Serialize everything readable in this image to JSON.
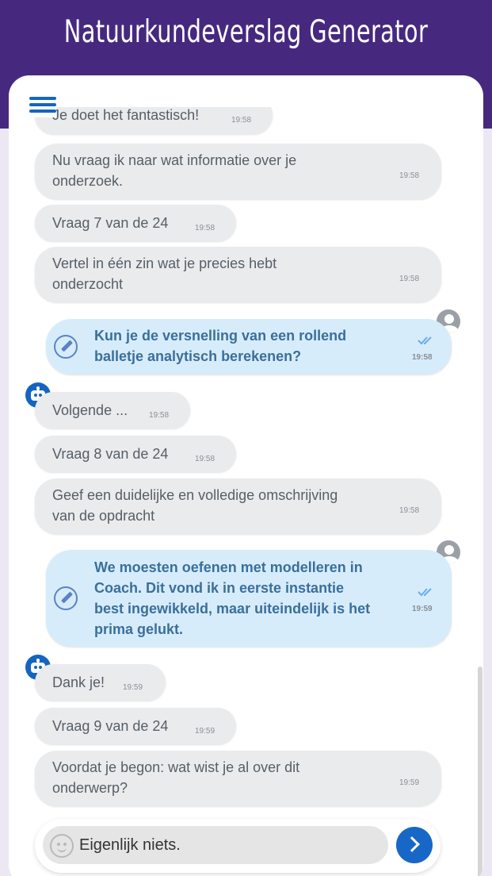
{
  "app": {
    "title": "Natuurkundeverslag Generator"
  },
  "messages": [
    {
      "text": "Je doet het fantastisch!",
      "time": "19:58"
    },
    {
      "line1": "Nu vraag ik naar wat informatie over je",
      "line2": "onderzoek.",
      "time": "19:58"
    },
    {
      "text": "Vraag 7 van de 24",
      "time": "19:58"
    },
    {
      "line1": "Vertel in één zin wat je precies hebt",
      "line2": "onderzocht",
      "time": "19:58"
    },
    {
      "line1": "Kun je de versnelling van een rollend",
      "line2": "balletje analytisch berekenen?",
      "time": "19:58"
    },
    {
      "text": "Volgende ...",
      "time": "19:58"
    },
    {
      "text": "Vraag 8 van de 24",
      "time": "19:58"
    },
    {
      "line1": "Geef een duidelijke en volledige omschrijving",
      "line2": "van de opdracht",
      "time": "19:58"
    },
    {
      "line1": "We moesten oefenen met modelleren in",
      "line2": "Coach. Dit vond ik in eerste instantie",
      "line3": "best ingewikkeld, maar uiteindelijk is het",
      "line4": "prima gelukt.",
      "time": "19:59"
    },
    {
      "text": "Dank je!",
      "time": "19:59"
    },
    {
      "text": "Vraag 9 van de 24",
      "time": "19:59"
    },
    {
      "line1": "Voordat je begon: wat wist je al over dit",
      "line2": "onderwerp?",
      "time": "19:59"
    }
  ],
  "composer": {
    "value": "Eigenlijk niets."
  },
  "icons": {
    "menu": "hamburger-icon",
    "bot": "robot-icon",
    "user": "user-avatar-icon",
    "edit": "pencil-icon",
    "read": "double-check-icon",
    "emoji": "smiley-icon",
    "send": "chevron-right-icon"
  },
  "colors": {
    "header": "#46297f",
    "accent": "#1565c0",
    "user_bubble": "#d7ecfa",
    "bot_bubble": "#eaebed"
  }
}
